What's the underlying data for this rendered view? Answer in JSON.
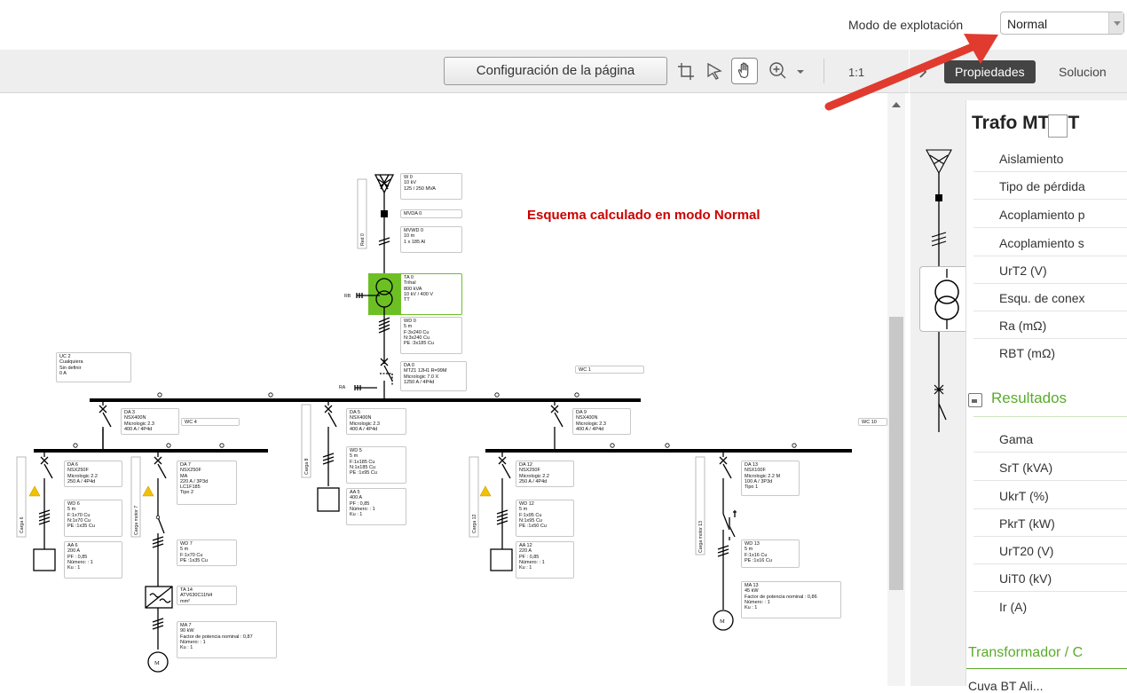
{
  "header": {
    "mode_label": "Modo de explotación",
    "mode_value": "Normal"
  },
  "toolbar": {
    "page_config": "Configuración de la página",
    "scale": "1:1"
  },
  "tabs": {
    "properties": "Propiedades",
    "solutions": "Solucion"
  },
  "canvas": {
    "mode_message": "Esquema calculado en modo Normal",
    "labels": {
      "w0": [
        "W 0",
        "10 kV",
        "125 / 250 MVA"
      ],
      "mvda0": [
        "MVDA 0"
      ],
      "mvwd0": [
        "MVWD 0",
        "10 m",
        "1 x 185 Al"
      ],
      "ta0": [
        "TA 0",
        "Trihal",
        "800 kVA",
        "10 kV / 400 V",
        "TT"
      ],
      "wd0": [
        "WD 0",
        "5 m",
        "F:3x240 Cu",
        "N:3x240 Cu",
        "PE :3x185 Cu"
      ],
      "da0": [
        "DA 0",
        "MTZ1 12H1  R=99M",
        "Micrologic 7.0 X",
        "1250 A / 4P4d"
      ],
      "uc2": [
        "UC 2",
        "Cualquiera",
        "Sin definir",
        "0 A"
      ],
      "wc1": [
        "WC 1"
      ],
      "wc4": [
        "WC 4"
      ],
      "wc10": [
        "WC 10"
      ],
      "da3": [
        "DA 3",
        "NSX400N",
        "Micrologic 2.3",
        "400 A / 4P4d"
      ],
      "da5": [
        "DA 5",
        "NSX400N",
        "Micrologic 2.3",
        "400 A / 4P4d"
      ],
      "da9": [
        "DA 9",
        "NSX400N",
        "Micrologic 2.3",
        "400 A / 4P4d"
      ],
      "da6": [
        "DA 6",
        "NSX250F",
        "Micrologic 2.2",
        "250 A / 4P4d"
      ],
      "da7": [
        "DA 7",
        "NSX250F",
        "MA",
        "220 A / 3P3d",
        "LC1F185",
        "Tipo 2"
      ],
      "wd5": [
        "WD 5",
        "5 m",
        "F:1x185 Cu",
        "N:1x185 Cu",
        "PE :1x95 Cu"
      ],
      "aa5": [
        "AA 5",
        "400 A",
        "PF : 0,85",
        "Número: : 1",
        "Ku : 1"
      ],
      "da12": [
        "DA 12",
        "NSX250F",
        "Micrologic 2.2",
        "250 A / 4P4d"
      ],
      "da13": [
        "DA 13",
        "NSX100F",
        "Micrologic 2.2 M",
        "100 A / 3P3d",
        "Tipo 1"
      ],
      "wd6": [
        "WD 6",
        "5 m",
        "F:1x70 Cu",
        "N:1x70 Cu",
        "PE :1x35 Cu"
      ],
      "aa6": [
        "AA 6",
        "200 A",
        "PF : 0,85",
        "Número: : 1",
        "Ku : 1"
      ],
      "wd7": [
        "WD 7",
        "5 m",
        "F:1x70 Cu",
        "PE :1x35 Cu"
      ],
      "ta14": [
        "TA 14",
        "ATV630C11N4",
        "mm²"
      ],
      "ma7": [
        "MA 7",
        "90 kW",
        "Factor de potencia nominal : 0,87",
        "Número: : 1",
        "Ku : 1"
      ],
      "wd12": [
        "WD 12",
        "5 m",
        "F:1x95 Cu",
        "N:1x95 Cu",
        "PE :1x50 Cu"
      ],
      "aa12": [
        "AA 12",
        "220 A",
        "PF : 0,85",
        "Número: : 1",
        "Ku : 1"
      ],
      "wd13": [
        "WD 13",
        "5 m",
        "F:1x16 Cu",
        "PE :1x16 Cu"
      ],
      "ma13": [
        "MA 13",
        "45 kW",
        "Factor de potencia nominal : 0,86",
        "Número: : 1",
        "Ku : 1"
      ],
      "red0": "Red 0",
      "rb": "RB",
      "ra": "RA",
      "carga6": "Carga 6",
      "cargamotor7": "Carga motor 7",
      "carga8": "Carga 8",
      "carga12": "Carga 12",
      "cargamotor13": "Carga motor 13",
      "motor": "M"
    }
  },
  "panel": {
    "title": "Trafo MT/BT",
    "properties": [
      "Aislamiento",
      "Tipo de pérdida",
      "Acoplamiento p",
      "Acoplamiento s",
      "UrT2 (V)",
      "Esqu. de conex",
      "Ra (mΩ)",
      "RBT (mΩ)"
    ],
    "results_title": "Resultados",
    "results": [
      "Gama",
      "SrT (kVA)",
      "UkrT (%)",
      "PkrT (kW)",
      "UrT20 (V)",
      "UiT0 (kV)",
      "Ir (A)"
    ],
    "section2": "Transformador / C",
    "section3": "Cuva BT Ali..."
  },
  "colors": {
    "accent_green": "#5aab2a",
    "transformer_fill": "#6cc024",
    "arrow_red": "#e03b2e",
    "message_red": "#cc0000"
  }
}
